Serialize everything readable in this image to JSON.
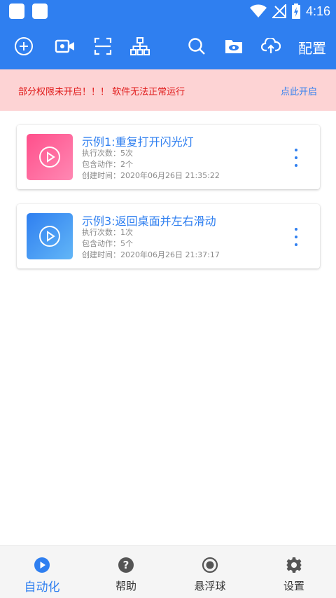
{
  "status": {
    "time": "4:16"
  },
  "toolbar": {
    "config_label": "配置",
    "icons": [
      "add-icon",
      "video-icon",
      "scan-icon",
      "hierarchy-icon",
      "search-icon",
      "folder-eye-icon",
      "cloud-upload-icon"
    ]
  },
  "warning": {
    "message": "部分权限未开启！！！ 软件无法正常运行",
    "action": "点此开启"
  },
  "scripts": [
    {
      "title": "示例1:重复打开闪光灯",
      "exec_count": "执行次数：5次",
      "actions": "包含动作：2个",
      "created": "创建时间：2020年06月26日 21:35:22"
    },
    {
      "title": "示例3:返回桌面并左右滑动",
      "exec_count": "执行次数：1次",
      "actions": "包含动作：5个",
      "created": "创建时间：2020年06月26日 21:37:17"
    }
  ],
  "nav": [
    {
      "label": "自动化",
      "icon": "play-circle-icon",
      "active": true
    },
    {
      "label": "帮助",
      "icon": "help-icon",
      "active": false
    },
    {
      "label": "悬浮球",
      "icon": "radio-icon",
      "active": false
    },
    {
      "label": "设置",
      "icon": "gear-icon",
      "active": false
    }
  ],
  "colors": {
    "primary": "#2f7ff0",
    "warning_bg": "#fdd3d4",
    "warning_text": "#e01818"
  }
}
